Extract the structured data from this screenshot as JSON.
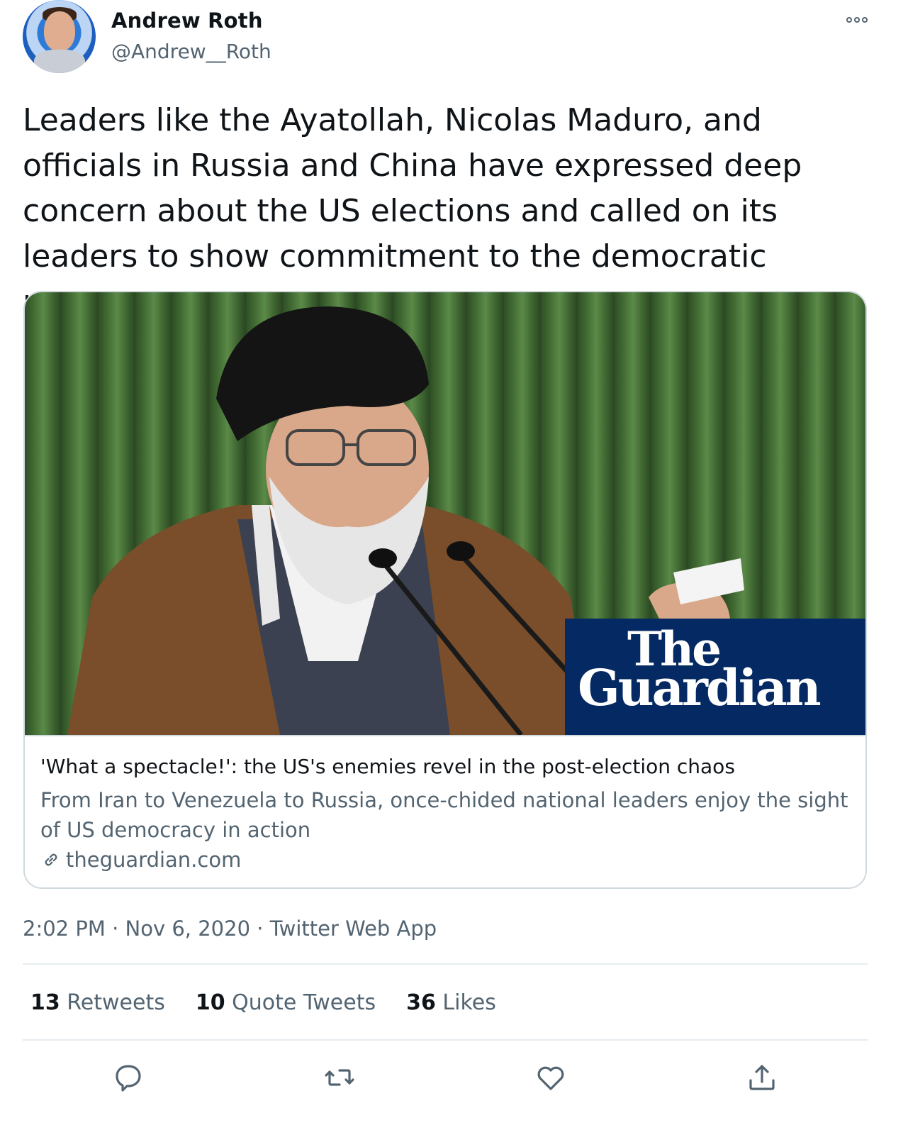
{
  "author": {
    "name": "Andrew Roth",
    "handle": "@Andrew__Roth",
    "avatar_icon": "avatar-icon"
  },
  "tweet": {
    "text": "Leaders like the Ayatollah, Nicolas Maduro, and officials in Russia and China have expressed deep concern about the US elections and called on its leaders to show commitment to the democratic process."
  },
  "card": {
    "image_logo_line1": "The",
    "image_logo_line2": "Guardian",
    "title": "'What a spectacle!': the US's enemies revel in the post-election chaos",
    "description": "From Iran to Venezuela to Russia, once-chided national leaders enjoy the sight of US democracy in action",
    "domain": "theguardian.com",
    "link_icon": "link-icon"
  },
  "meta": {
    "time": "2:02 PM",
    "separator": "·",
    "date": "Nov 6, 2020",
    "source": "Twitter Web App"
  },
  "stats": {
    "retweets_count": "13",
    "retweets_label": "Retweets",
    "quotes_count": "10",
    "quotes_label": "Quote Tweets",
    "likes_count": "36",
    "likes_label": "Likes"
  },
  "actions": [
    "reply-icon",
    "retweet-icon",
    "like-icon",
    "share-icon"
  ],
  "colors": {
    "text": "#0f1419",
    "secondary": "#536471",
    "border": "#cfd9de",
    "guardian_blue": "#052962"
  }
}
